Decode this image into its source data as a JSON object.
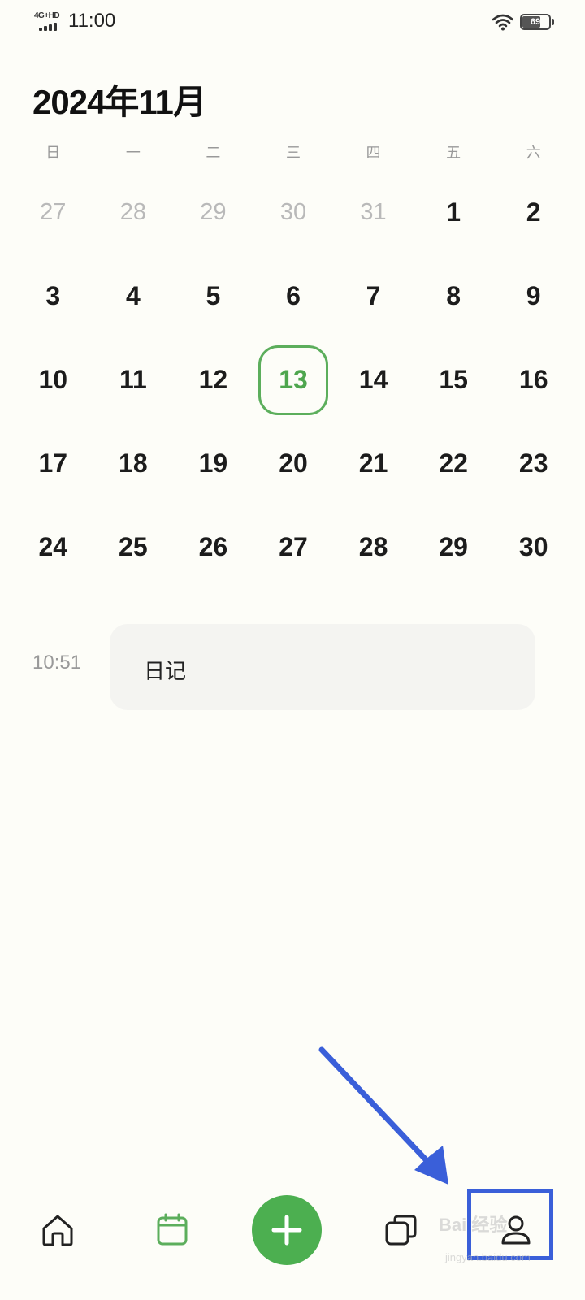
{
  "status_bar": {
    "network": "4G+HD",
    "time": "11:00",
    "battery_level": "69",
    "battery_fraction": 0.69
  },
  "calendar": {
    "month_title": "2024年11月",
    "weekdays": [
      "日",
      "一",
      "二",
      "三",
      "四",
      "五",
      "六"
    ],
    "days": [
      {
        "label": "27",
        "muted": true
      },
      {
        "label": "28",
        "muted": true
      },
      {
        "label": "29",
        "muted": true
      },
      {
        "label": "30",
        "muted": true
      },
      {
        "label": "31",
        "muted": true
      },
      {
        "label": "1"
      },
      {
        "label": "2"
      },
      {
        "label": "3"
      },
      {
        "label": "4"
      },
      {
        "label": "5"
      },
      {
        "label": "6"
      },
      {
        "label": "7"
      },
      {
        "label": "8"
      },
      {
        "label": "9"
      },
      {
        "label": "10"
      },
      {
        "label": "11"
      },
      {
        "label": "12"
      },
      {
        "label": "13",
        "today": true
      },
      {
        "label": "14"
      },
      {
        "label": "15"
      },
      {
        "label": "16"
      },
      {
        "label": "17"
      },
      {
        "label": "18"
      },
      {
        "label": "19"
      },
      {
        "label": "20"
      },
      {
        "label": "21"
      },
      {
        "label": "22"
      },
      {
        "label": "23"
      },
      {
        "label": "24"
      },
      {
        "label": "25"
      },
      {
        "label": "26"
      },
      {
        "label": "27"
      },
      {
        "label": "28"
      },
      {
        "label": "29"
      },
      {
        "label": "30"
      }
    ],
    "today_color": "#4ea64e"
  },
  "entries": [
    {
      "time": "10:51",
      "title": "日记"
    }
  ],
  "bottom_nav": {
    "items": [
      {
        "icon": "home-icon"
      },
      {
        "icon": "calendar-icon",
        "active": true
      },
      {
        "icon": "plus-icon"
      },
      {
        "icon": "cards-icon"
      },
      {
        "icon": "profile-icon"
      }
    ],
    "accent_color": "#4caf50"
  },
  "annotation": {
    "arrow_color": "#3a5fd9",
    "watermark": "Bai 经验",
    "watermark_sub": "jingyan.baidu.com"
  }
}
